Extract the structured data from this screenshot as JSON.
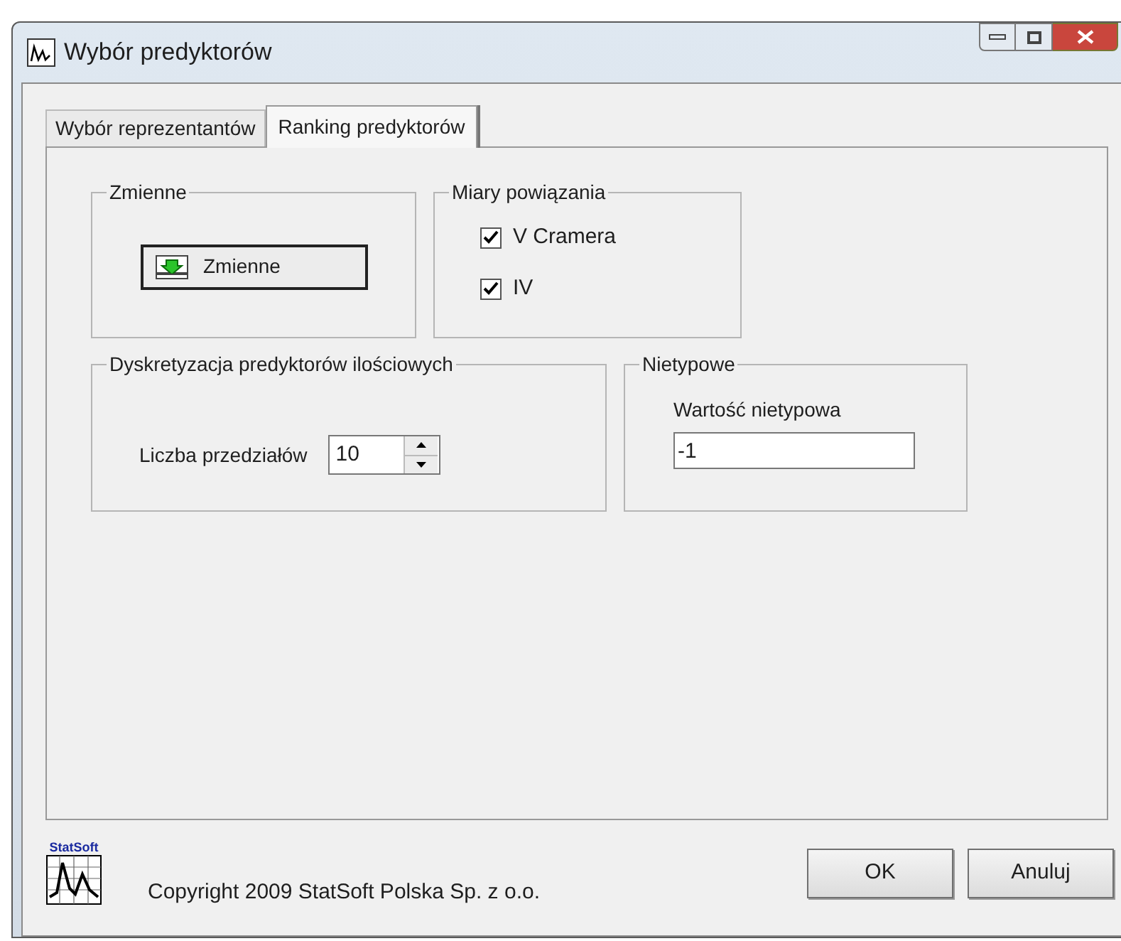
{
  "window": {
    "title": "Wybór predyktorów"
  },
  "tabs": [
    {
      "label": "Wybór reprezentantów",
      "selected": false
    },
    {
      "label": "Ranking predyktorów",
      "selected": true
    }
  ],
  "groups": {
    "variables": {
      "title": "Zmienne",
      "button": "Zmienne"
    },
    "measures": {
      "title": "Miary powiązania",
      "items": [
        {
          "label": "V Cramera",
          "checked": true
        },
        {
          "label": "IV",
          "checked": true
        }
      ]
    },
    "discretization": {
      "title": "Dyskretyzacja predyktorów ilościowych",
      "label": "Liczba przedziałów",
      "value": "10"
    },
    "atypical": {
      "title": "Nietypowe",
      "label": "Wartość nietypowa",
      "value": "-1"
    }
  },
  "footer": {
    "logo_text": "StatSoft",
    "copyright": "Copyright 2009 StatSoft Polska Sp. z o.o.",
    "buttons": [
      "OK",
      "Anuluj"
    ]
  }
}
